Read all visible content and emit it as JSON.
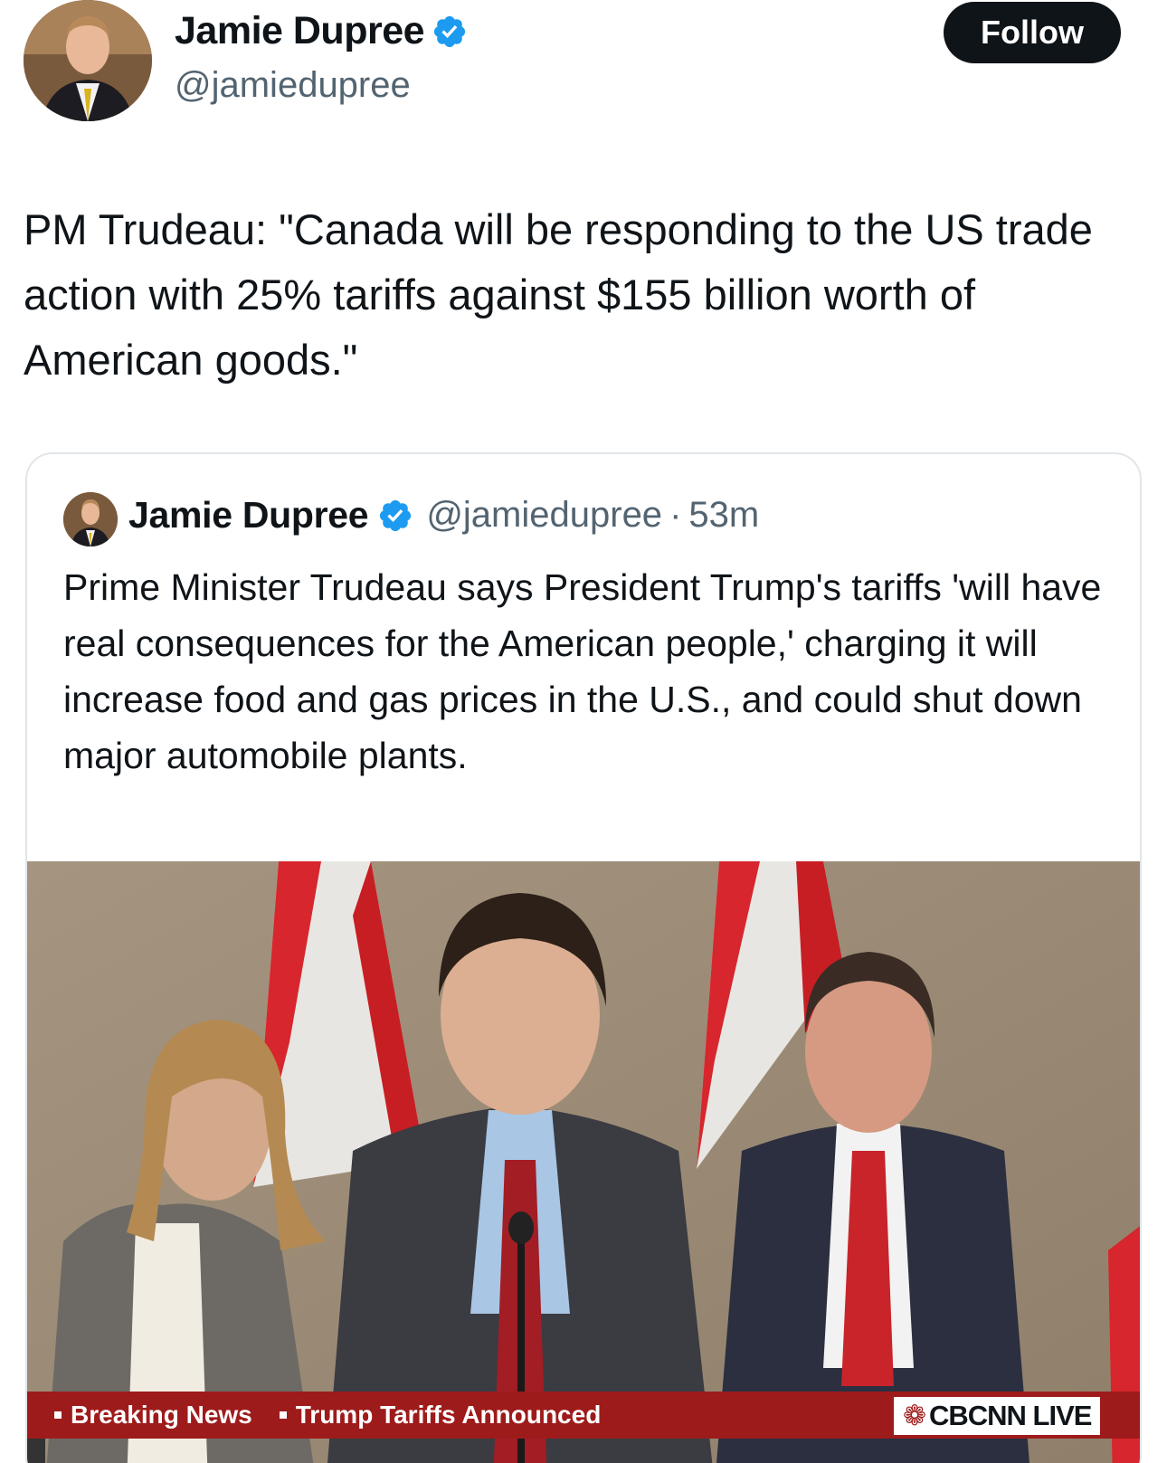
{
  "author": {
    "name": "Jamie Dupree",
    "handle": "@jamiedupree",
    "follow_label": "Follow"
  },
  "tweet": {
    "text": "PM Trudeau: \"Canada will be responding to the US trade action with 25% tariffs against $155 billion worth of American goods.\""
  },
  "quoted_tweet": {
    "name": "Jamie Dupree",
    "handle": "@jamiedupree",
    "separator": "·",
    "time": "53m",
    "text": "Prime Minister Trudeau says President Trump's tariffs 'will have real consequences for the American people,' charging it will increase food and gas prices in the U.S., and could shut down major automobile plants.",
    "media": {
      "ticker_items": [
        "Breaking News",
        "Trump Tariffs Announced"
      ],
      "channel_badge": "CBCNN LIVE"
    }
  },
  "colors": {
    "verified": "#1d9bf0",
    "follow_bg": "#0f1419",
    "ticker_bg": "#9e1b1b"
  }
}
